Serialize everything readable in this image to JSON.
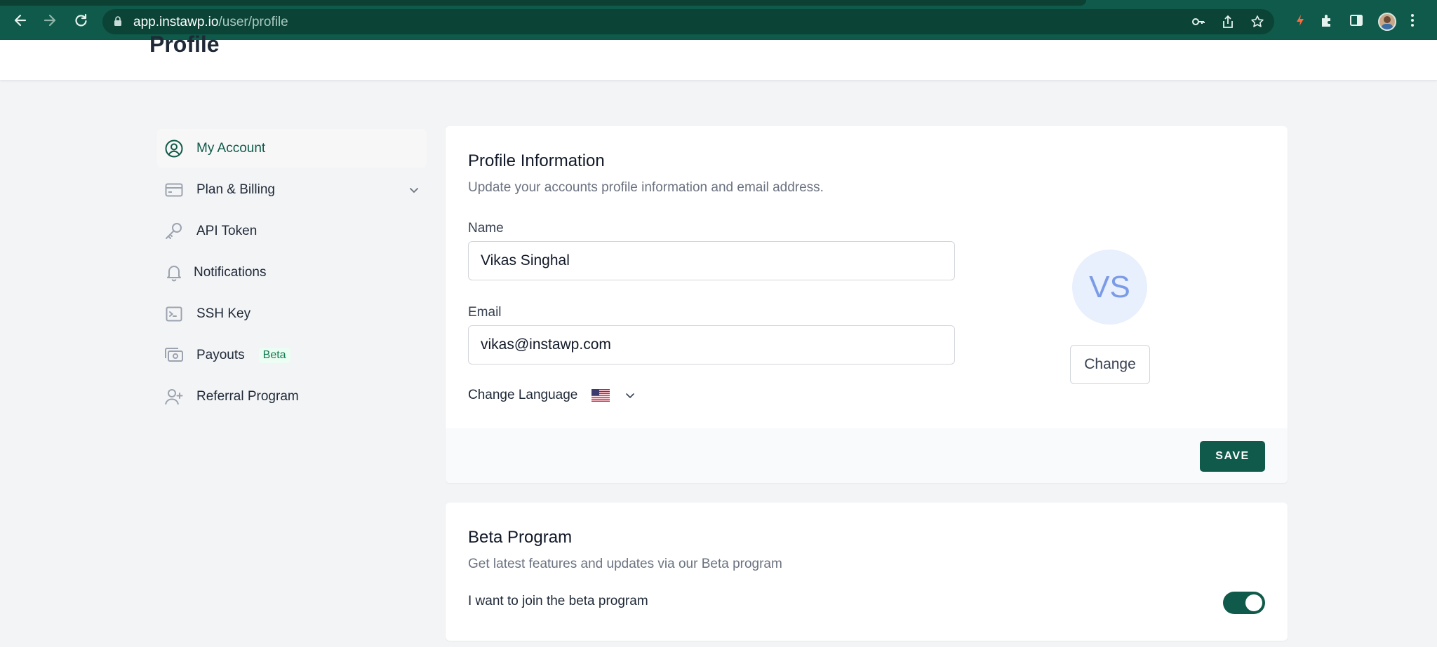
{
  "browser": {
    "url_host": "app.instawp.io",
    "url_path": "/user/profile"
  },
  "page": {
    "title": "Profile"
  },
  "sidebar": {
    "items": [
      {
        "label": "My Account",
        "icon": "user-circle-icon",
        "active": true
      },
      {
        "label": "Plan & Billing",
        "icon": "credit-card-icon"
      },
      {
        "label": "API Token",
        "icon": "key-icon"
      },
      {
        "label": "Notifications",
        "icon": "bell-icon"
      },
      {
        "label": "SSH Key",
        "icon": "terminal-icon"
      },
      {
        "label": "Payouts",
        "icon": "cash-icon",
        "badge": "Beta"
      },
      {
        "label": "Referral Program",
        "icon": "user-plus-icon"
      }
    ]
  },
  "profile": {
    "title": "Profile Information",
    "subtitle": "Update your accounts profile information and email address.",
    "name_label": "Name",
    "name_value": "Vikas Singhal",
    "email_label": "Email",
    "email_value": "vikas@instawp.com",
    "language_label": "Change Language",
    "language_icon": "us-flag-icon",
    "avatar_initials": "VS",
    "change_label": "Change",
    "save_label": "SAVE"
  },
  "beta": {
    "title": "Beta Program",
    "subtitle": "Get latest features and updates via our Beta program",
    "toggle_label": "I want to join the beta program",
    "enabled": true
  },
  "colors": {
    "brand": "#0f5a4a",
    "avatar_bg": "#e8effd",
    "avatar_text": "#7b9be6"
  }
}
